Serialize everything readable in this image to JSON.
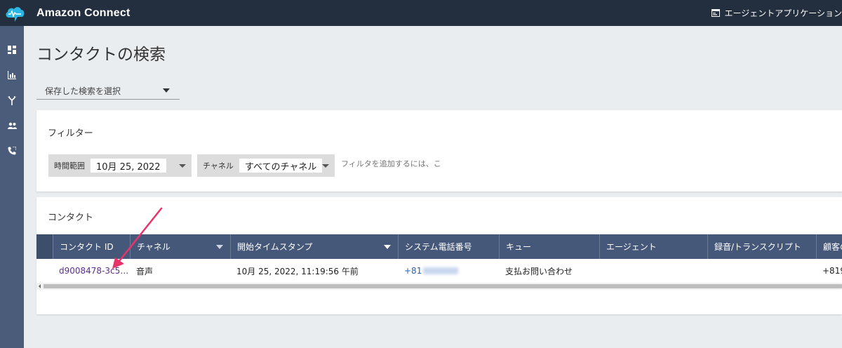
{
  "header": {
    "app_title": "Amazon Connect",
    "agent_app_label": "エージェントアプリケーション",
    "icons": [
      "cloud-logo-icon",
      "window-icon"
    ]
  },
  "sidebar": {
    "items": [
      {
        "name": "dashboard",
        "icon": "dashboard-icon"
      },
      {
        "name": "metrics",
        "icon": "bar-chart-icon"
      },
      {
        "name": "routing",
        "icon": "routing-icon"
      },
      {
        "name": "users",
        "icon": "users-icon"
      },
      {
        "name": "channels",
        "icon": "phone-icon"
      }
    ]
  },
  "page": {
    "title": "コンタクトの検索",
    "saved_search_placeholder": "保存した検索を選択"
  },
  "filter": {
    "title": "フィルター",
    "time_range_label": "時間範囲",
    "time_range_value": "10月 25, 2022",
    "channel_label": "チャネル",
    "channel_value": "すべてのチャネル",
    "add_filter_placeholder": "フィルタを追加するには、こ"
  },
  "contacts": {
    "title": "コンタクト",
    "columns": [
      "コンタクト ID",
      "チャネル",
      "開始タイムスタンプ",
      "システム電話番号",
      "キュー",
      "エージェント",
      "録音/トランスクリプト",
      "顧客の"
    ],
    "rows": [
      {
        "contact_id": "d9008478-3c5…",
        "channel": "音声",
        "start_timestamp": "10月 25, 2022, 11:19:56 午前",
        "system_phone_prefix": "+81",
        "queue": "支払お問い合わせ",
        "agent": "",
        "recording": "",
        "customer_prefix": "+819"
      }
    ]
  },
  "colors": {
    "topbar": "#232f3e",
    "sidebar": "#4b5c7a",
    "table_header": "#46587a",
    "link": "#5b2f8c",
    "annotation_arrow": "#e8336b"
  }
}
